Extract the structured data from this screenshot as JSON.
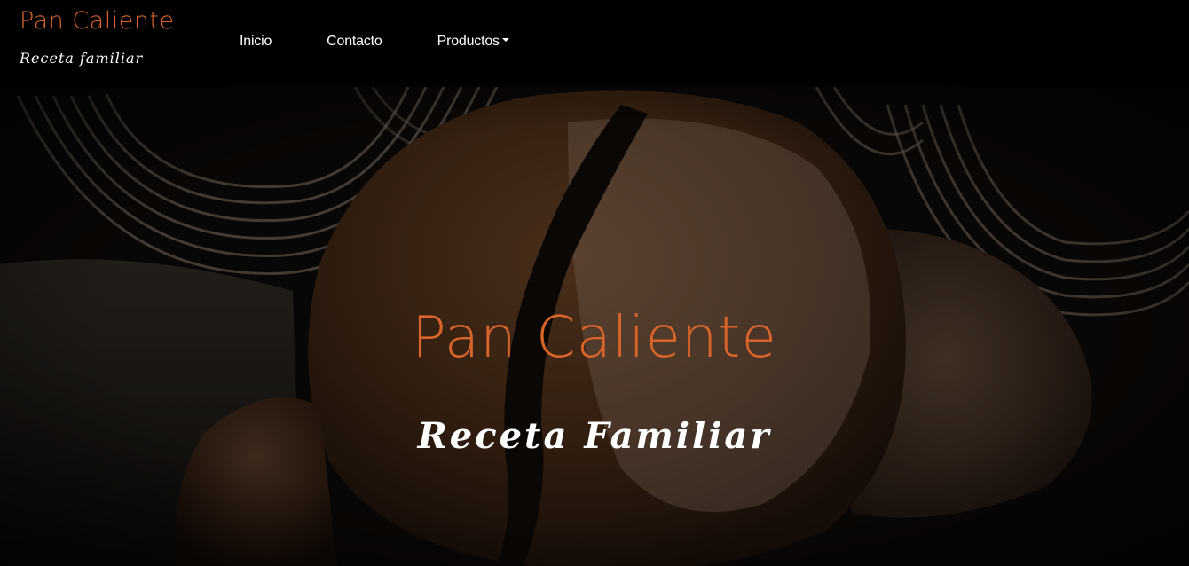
{
  "colors": {
    "accent": "#d9642a",
    "nav_text": "#ffffff",
    "navbar_bg": "#000000",
    "subtitle": "#ffffff"
  },
  "navbar": {
    "brand": {
      "name": "Pan Caliente",
      "tagline": "Receta familiar"
    },
    "links": [
      {
        "label": "Inicio"
      },
      {
        "label": "Contacto"
      },
      {
        "label": "Productos",
        "has_dropdown": true
      }
    ]
  },
  "hero": {
    "title": "Pan Caliente",
    "subtitle": "Receta Familiar",
    "background_image": "bread-loaves-with-baskets"
  }
}
